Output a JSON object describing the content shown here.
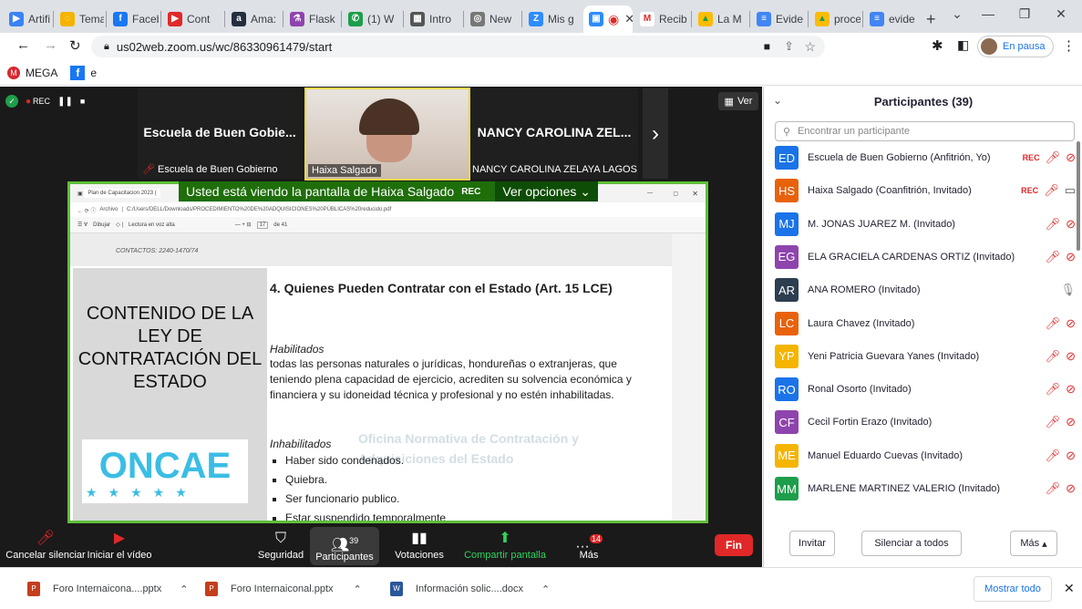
{
  "browser": {
    "tabs": [
      "Artifi",
      "Tema",
      "Faceb",
      "Cont",
      "Ama:",
      "Flask",
      "(1) W",
      "Intro",
      "New",
      "Mis g",
      "",
      "Recib",
      "La M",
      "Evide",
      "proce",
      "evide"
    ],
    "active_tab_index": 10,
    "new_tab": "+",
    "url": "us02web.zoom.us/wc/86330961479/start",
    "profile_status": "En pausa",
    "bookmarks": [
      "MEGA",
      "e"
    ]
  },
  "zoom": {
    "rec_label": "REC",
    "view_label": "Ver",
    "tiles": [
      {
        "big": "Escuela de Buen Gobie...",
        "name": "Escuela de Buen Gobierno"
      },
      {
        "big": "",
        "name": "Haixa Salgado"
      },
      {
        "big": "NANCY CAROLINA ZEL...",
        "name": "NANCY CAROLINA ZELAYA LAGOS"
      }
    ],
    "share_banner": "Usted está viendo la pantalla de Haixa Salgado",
    "banner_rec": "REC",
    "view_options": "Ver opciones",
    "pdf": {
      "tab_title": "Plan de Capacitacion 2023 (",
      "path_label": "Archivo",
      "path": "C:/Users/DELL/Downloads/PROCEDIMIENTO%20DE%20ADQUISICIONES%20PÚBLICAS%20reducido.pdf",
      "draw": "Dibujar",
      "read_aloud": "Lectura en voz alta",
      "page": "17",
      "of": "de 41",
      "contacts": "CONTACTOS: 2240-1470/74",
      "left_title": "CONTENIDO DE LA LEY DE CONTRATACIÓN DEL ESTADO",
      "logo": "ONCAE",
      "heading": "4. Quienes Pueden Contratar con el Estado (Art. 15 LCE)",
      "sub1": "Habilitados",
      "para1": "todas las personas naturales o jurídicas, hondureñas o extranjeras, que teniendo plena capacidad de ejercicio, acrediten su solvencia económica y financiera y su idoneidad técnica y profesional  y no estén inhabilitadas.",
      "sub2": "Inhabilitados",
      "bullets": [
        "Haber sido condenados.",
        "Quiebra.",
        "Ser funcionario publico.",
        "Estar suspendido temporalmente"
      ],
      "watermark": "Oficina Normativa de Contratación y Adquisiciones del Estado"
    },
    "toolbar": {
      "mute": "Cancelar silenciar",
      "video": "Iniciar el vídeo",
      "security": "Seguridad",
      "participants": "Participantes",
      "participants_count": "39",
      "polls": "Votaciones",
      "share": "Compartir pantalla",
      "more": "Más",
      "more_badge": "14",
      "end": "Fin"
    }
  },
  "panel": {
    "title": "Participantes (39)",
    "search_placeholder": "Encontrar un participante",
    "participants": [
      {
        "initials": "ED",
        "color": "#1a73e8",
        "name": "Escuela de Buen Gobierno (Anfitrión, Yo)",
        "rec": "REC"
      },
      {
        "initials": "HS",
        "color": "#e8620c",
        "name": "Haixa Salgado (Coanfitrión, Invitado)",
        "rec": "REC"
      },
      {
        "initials": "MJ",
        "color": "#1a73e8",
        "name": "M. JONAS JUAREZ M. (Invitado)",
        "rec": ""
      },
      {
        "initials": "EG",
        "color": "#8e44ad",
        "name": "ELA GRACIELA CARDENAS ORTIZ (Invitado)",
        "rec": ""
      },
      {
        "initials": "AR",
        "color": "#2c3e50",
        "name": "ANA ROMERO (Invitado)",
        "rec": ""
      },
      {
        "initials": "LC",
        "color": "#e8620c",
        "name": "Laura Chavez (Invitado)",
        "rec": ""
      },
      {
        "initials": "YP",
        "color": "#f4b400",
        "name": "Yeni Patricia Guevara Yanes (Invitado)",
        "rec": ""
      },
      {
        "initials": "RO",
        "color": "#1a73e8",
        "name": "Ronal Osorto (Invitado)",
        "rec": ""
      },
      {
        "initials": "CF",
        "color": "#8e44ad",
        "name": "Cecil Fortin Erazo (Invitado)",
        "rec": ""
      },
      {
        "initials": "ME",
        "color": "#f4b400",
        "name": "Manuel Eduardo Cuevas (Invitado)",
        "rec": ""
      },
      {
        "initials": "MM",
        "color": "#1e9e4a",
        "name": "MARLENE MARTINEZ VALERIO (Invitado)",
        "rec": ""
      }
    ],
    "invite": "Invitar",
    "mute_all": "Silenciar a todos",
    "more": "Más"
  },
  "downloads": {
    "items": [
      "Foro Internaicona....pptx",
      "Foro Internaiconal.pptx",
      "Información solic....docx"
    ],
    "show_all": "Mostrar todo"
  }
}
